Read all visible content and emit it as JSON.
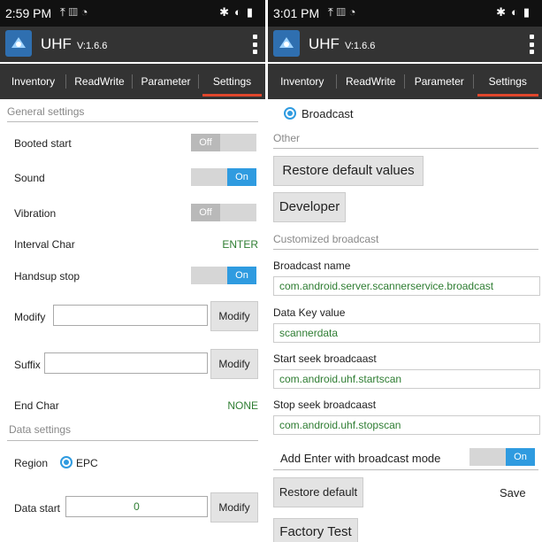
{
  "left": {
    "status": {
      "time": "2:59 PM"
    },
    "appbar": {
      "title": "UHF",
      "version": "V:1.6.6"
    },
    "tabs": [
      "Inventory",
      "ReadWrite",
      "Parameter",
      "Settings"
    ],
    "general_title": "General settings",
    "booted_start": {
      "label": "Booted start",
      "state": "Off"
    },
    "sound": {
      "label": "Sound",
      "state": "On"
    },
    "vibration": {
      "label": "Vibration",
      "state": "Off"
    },
    "interval_char": {
      "label": "Interval Char",
      "value": "ENTER"
    },
    "handsup_stop": {
      "label": "Handsup stop",
      "state": "On"
    },
    "modify_row": {
      "label": "Modify",
      "value": "",
      "button": "Modify"
    },
    "suffix_row": {
      "label": "Suffix",
      "value": "",
      "button": "Modify"
    },
    "end_char": {
      "label": "End Char",
      "value": "NONE"
    },
    "data_title": "Data settings",
    "region": {
      "label": "Region",
      "option": "EPC"
    },
    "data_start": {
      "label": "Data start",
      "value": "0",
      "button": "Modify"
    }
  },
  "right": {
    "status": {
      "time": "3:01 PM"
    },
    "appbar": {
      "title": "UHF",
      "version": "V:1.6.6"
    },
    "tabs": [
      "Inventory",
      "ReadWrite",
      "Parameter",
      "Settings"
    ],
    "broadcast_option": "Broadcast",
    "other_title": "Other",
    "restore_defaults_button": "Restore default values",
    "developer_button": "Developer",
    "customized_title": "Customized broadcast",
    "broadcast_name": {
      "label": "Broadcast name",
      "value": "com.android.server.scannerservice.broadcast"
    },
    "data_key": {
      "label": "Data Key value",
      "value": "scannerdata"
    },
    "start_seek": {
      "label": "Start seek broadcaast",
      "value": "com.android.uhf.startscan"
    },
    "stop_seek": {
      "label": "Stop seek broadcaast",
      "value": "com.android.uhf.stopscan"
    },
    "add_enter": {
      "label": "Add Enter with broadcast mode",
      "state": "On"
    },
    "restore_default_button": "Restore default",
    "save_button": "Save",
    "factory_test_button": "Factory Test"
  },
  "colors": {
    "accent": "#2f9be0",
    "tab_indicator": "#e0462c",
    "value_green": "#2e7d32",
    "appbar": "#333333"
  }
}
